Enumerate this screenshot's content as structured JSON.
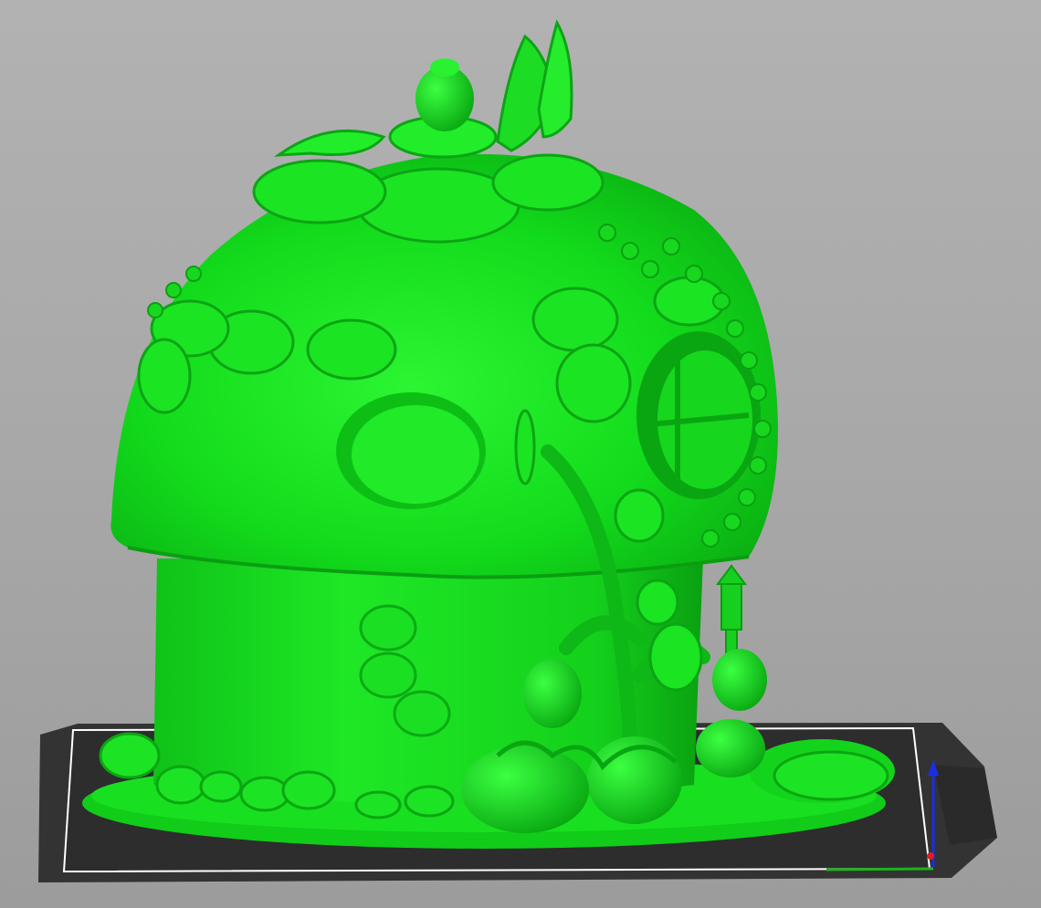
{
  "viewport": {
    "background_top": "#b2b2b2",
    "background_bottom": "#9c9c9c"
  },
  "build_plate": {
    "color": "#2b2b2b",
    "outline_color": "#ffffff"
  },
  "model": {
    "name": "mushroom-strawberry-fairy-house",
    "color": "#14e01e",
    "shade_color": "#0aa512",
    "highlight_color": "#33ff3a"
  },
  "axes": {
    "x_axis_color": "#1db31d",
    "y_axis_color": "#e02020",
    "z_axis_color": "#1a2ee0"
  }
}
